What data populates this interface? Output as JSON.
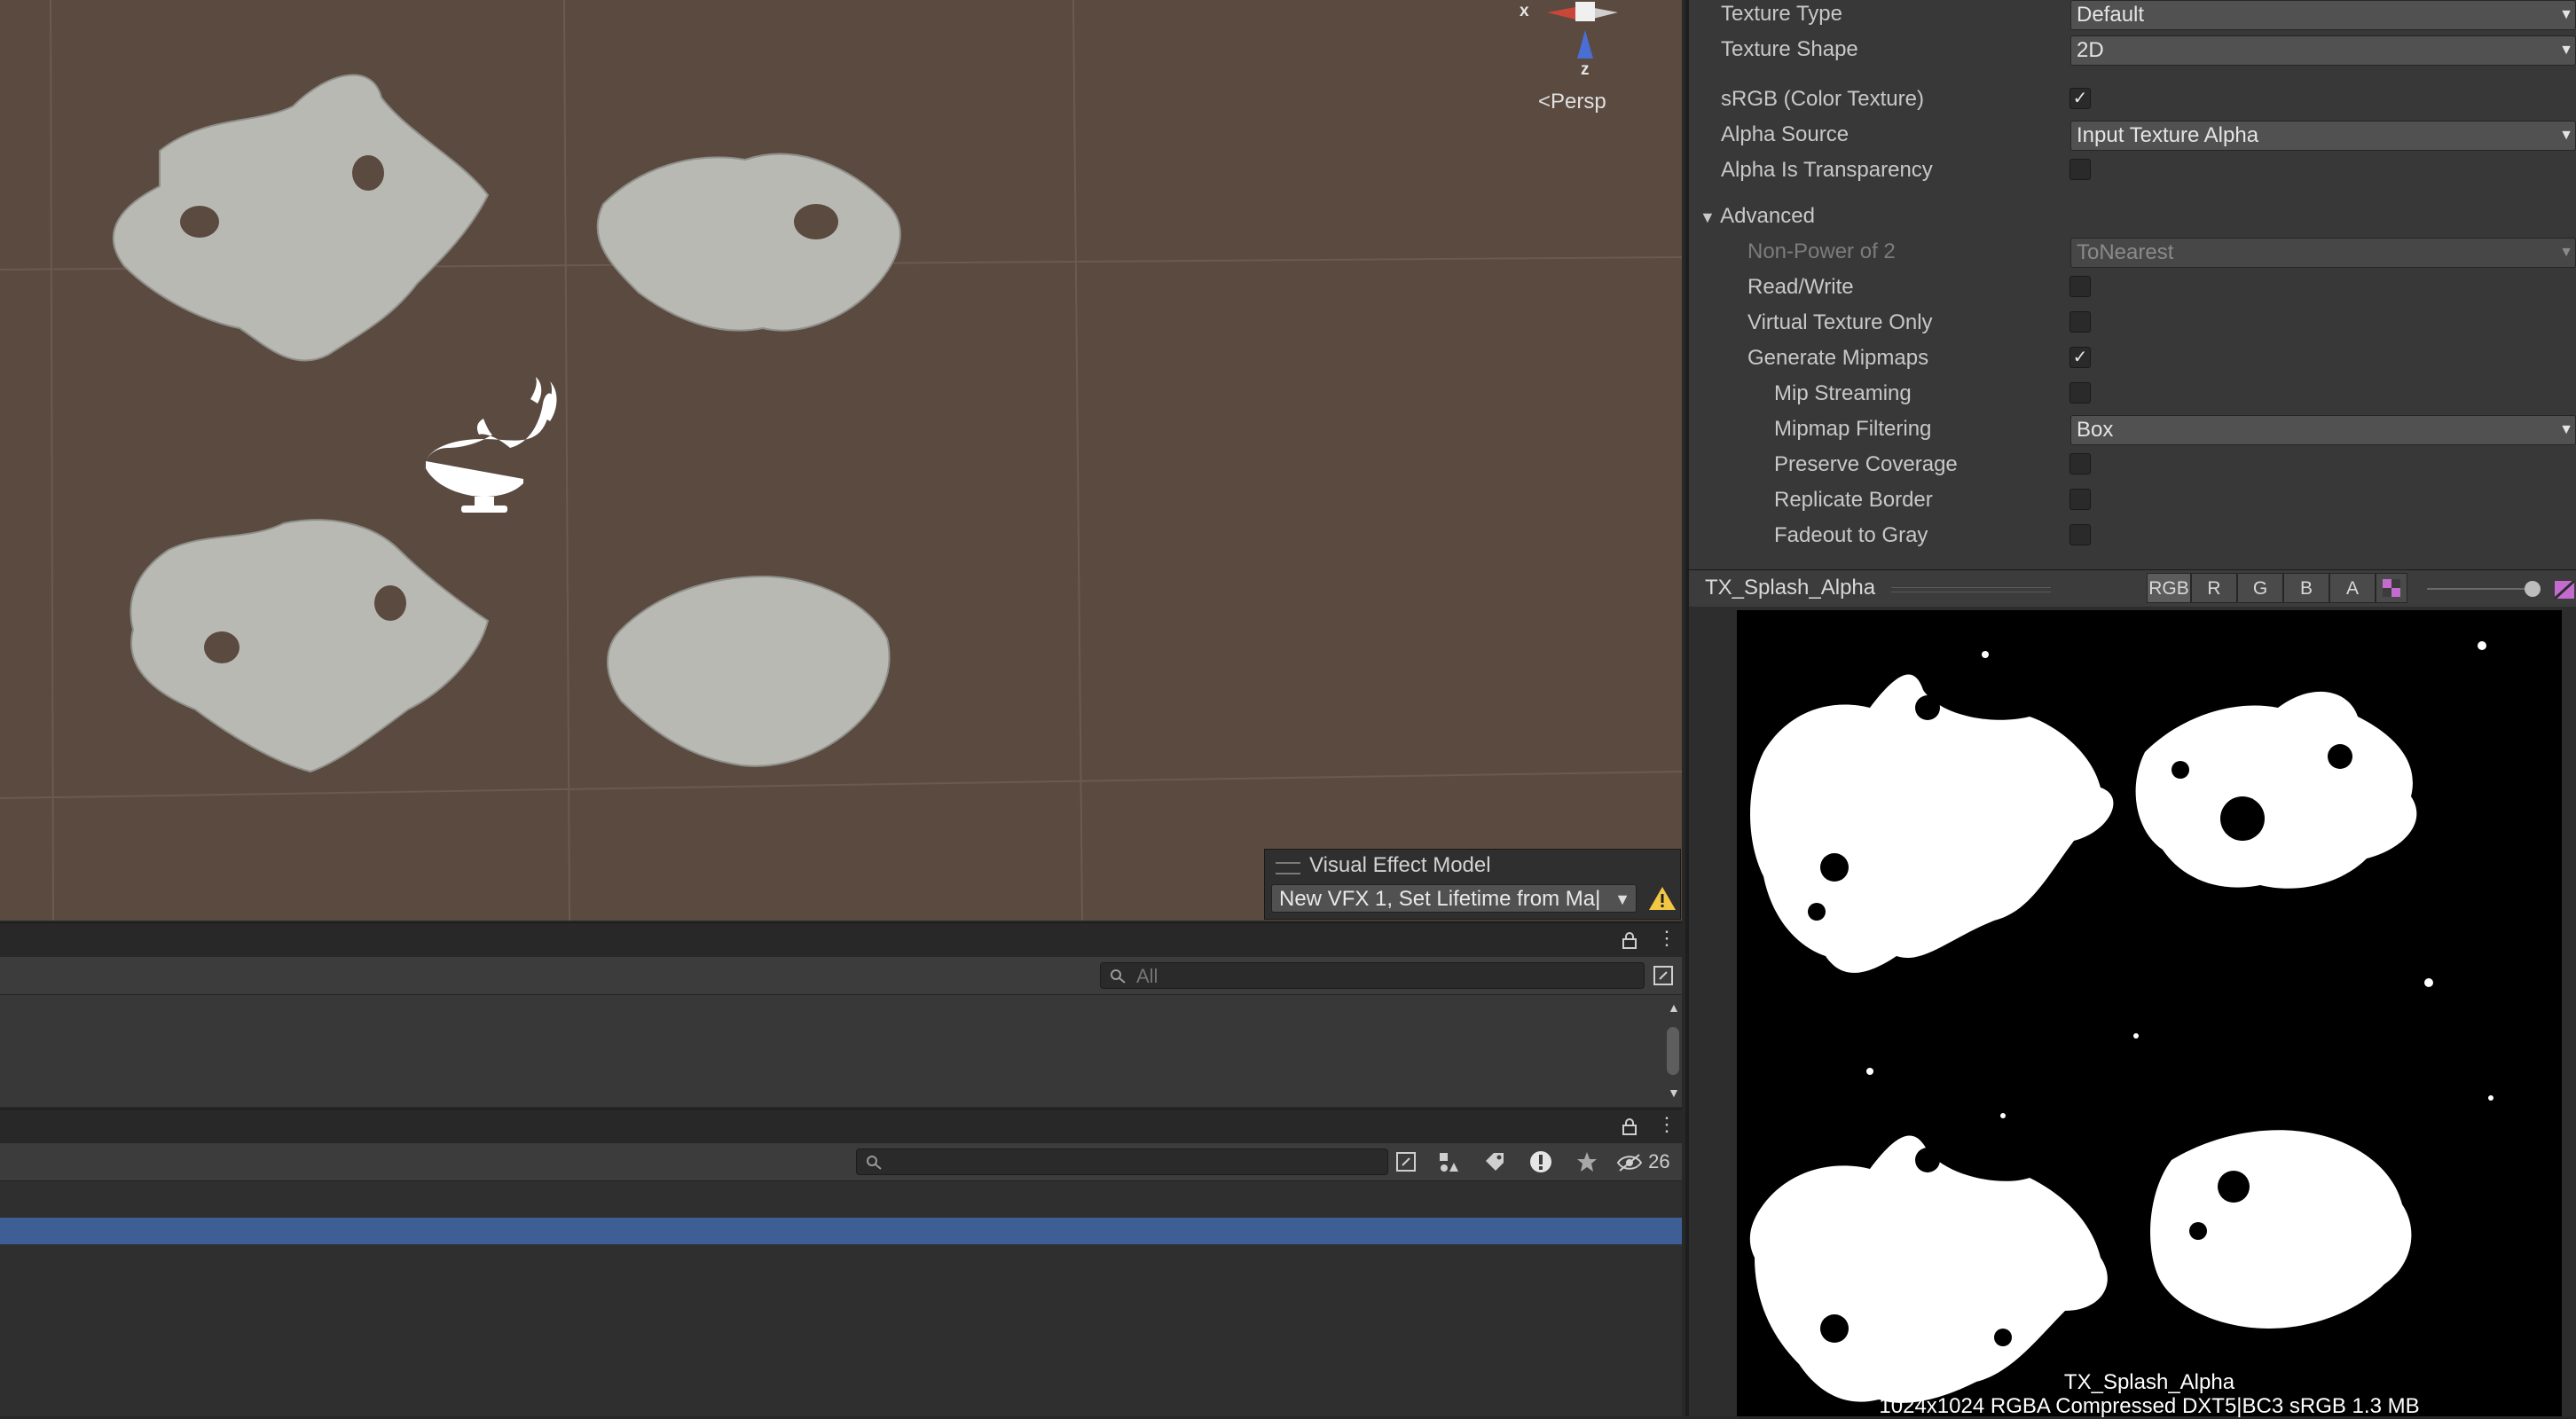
{
  "scene": {
    "gizmo": {
      "x_label": "x",
      "z_label": "z"
    },
    "persp_label": "Persp",
    "vfx_overlay": {
      "title": "Visual Effect Model",
      "selected": "New VFX 1, Set Lifetime from Ma|"
    }
  },
  "upper_panel": {
    "search_placeholder": "All"
  },
  "lower_panel": {
    "hidden_count": "26"
  },
  "inspector": {
    "texture_type": {
      "label": "Texture Type",
      "value": "Default"
    },
    "texture_shape": {
      "label": "Texture Shape",
      "value": "2D"
    },
    "srgb": {
      "label": "sRGB (Color Texture)",
      "checked": true
    },
    "alpha_source": {
      "label": "Alpha Source",
      "value": "Input Texture Alpha"
    },
    "alpha_transparency": {
      "label": "Alpha Is Transparency",
      "checked": false
    },
    "advanced": {
      "label": "Advanced"
    },
    "npot": {
      "label": "Non-Power of 2",
      "value": "ToNearest"
    },
    "read_write": {
      "label": "Read/Write",
      "checked": false
    },
    "virtual_texture": {
      "label": "Virtual Texture Only",
      "checked": false
    },
    "generate_mipmaps": {
      "label": "Generate Mipmaps",
      "checked": true
    },
    "mip_streaming": {
      "label": "Mip Streaming",
      "checked": false
    },
    "mipmap_filtering": {
      "label": "Mipmap Filtering",
      "value": "Box"
    },
    "preserve_coverage": {
      "label": "Preserve Coverage",
      "checked": false
    },
    "replicate_border": {
      "label": "Replicate Border",
      "checked": false
    },
    "fadeout_gray": {
      "label": "Fadeout to Gray",
      "checked": false
    }
  },
  "preview": {
    "title": "TX_Splash_Alpha",
    "channels": [
      "RGB",
      "R",
      "G",
      "B",
      "A"
    ],
    "caption_name": "TX_Splash_Alpha",
    "caption_info": "1024x1024  RGBA Compressed DXT5|BC3 sRGB  1.3 MB"
  }
}
